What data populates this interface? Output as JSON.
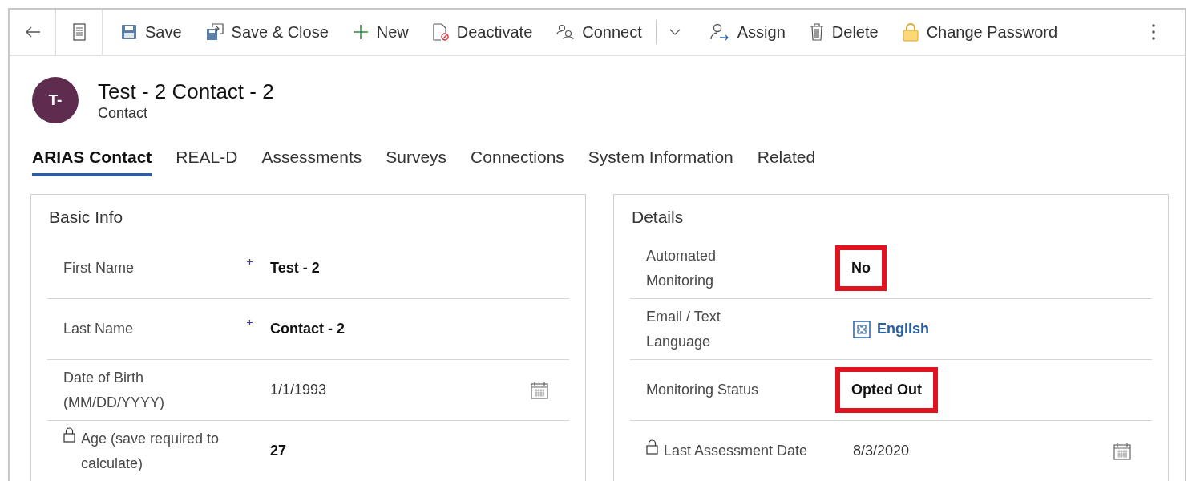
{
  "commands": [
    {
      "label": "Save"
    },
    {
      "label": "Save & Close"
    },
    {
      "label": "New"
    },
    {
      "label": "Deactivate"
    },
    {
      "label": "Connect"
    },
    {
      "label": "Assign"
    },
    {
      "label": "Delete"
    },
    {
      "label": "Change Password"
    }
  ],
  "record": {
    "initials": "T-",
    "title": "Test - 2 Contact - 2",
    "entity": "Contact"
  },
  "tabs": [
    {
      "label": "ARIAS Contact",
      "selected": true
    },
    {
      "label": "REAL-D",
      "selected": false
    },
    {
      "label": "Assessments",
      "selected": false
    },
    {
      "label": "Surveys",
      "selected": false
    },
    {
      "label": "Connections",
      "selected": false
    },
    {
      "label": "System Information",
      "selected": false
    },
    {
      "label": "Related",
      "selected": false
    }
  ],
  "sections": [
    {
      "title": "Basic Info",
      "fields": [
        {
          "label": "First Name",
          "value": "Test - 2",
          "kind": "text",
          "required": true,
          "locked": false,
          "highlighted": false
        },
        {
          "label": "Last Name",
          "value": "Contact - 2",
          "kind": "text",
          "required": true,
          "locked": false,
          "highlighted": false
        },
        {
          "label": "Date of Birth\n(MM/DD/YYYY)",
          "value": "1/1/1993",
          "kind": "date",
          "required": false,
          "locked": false,
          "highlighted": false
        },
        {
          "label": "Age (save required to\ncalculate)",
          "value": "27",
          "kind": "text",
          "required": false,
          "locked": true,
          "highlighted": false
        }
      ]
    },
    {
      "title": "Details",
      "fields": [
        {
          "label": "Automated\nMonitoring",
          "value": "No",
          "kind": "text",
          "required": false,
          "locked": false,
          "highlighted": true
        },
        {
          "label": "Email / Text\nLanguage",
          "value": "English",
          "kind": "lookup",
          "required": false,
          "locked": false,
          "highlighted": false
        },
        {
          "label": "Monitoring Status",
          "value": "Opted Out",
          "kind": "text",
          "required": false,
          "locked": false,
          "highlighted": true
        },
        {
          "label": "Last Assessment Date",
          "value": "8/3/2020",
          "kind": "date",
          "required": false,
          "locked": true,
          "highlighted": false
        }
      ]
    }
  ]
}
